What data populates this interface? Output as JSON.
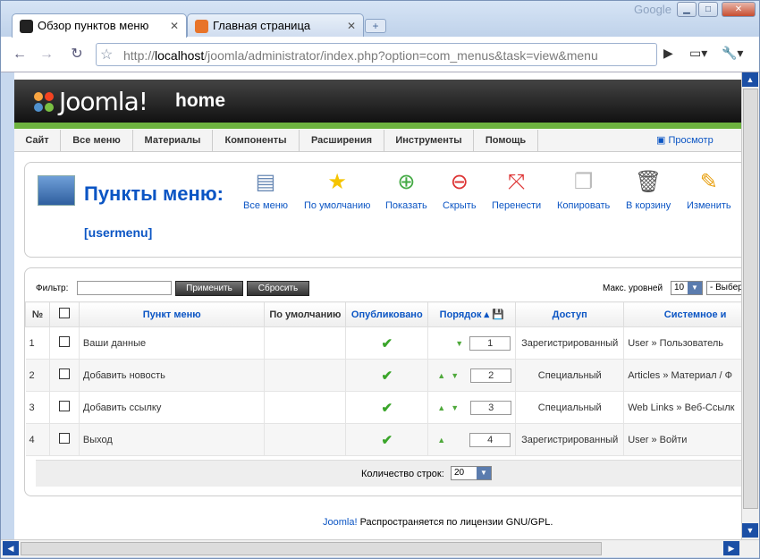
{
  "browser": {
    "tabs": [
      {
        "title": "Обзор пунктов меню"
      },
      {
        "title": "Главная страница"
      }
    ],
    "brand": "Google",
    "url_prefix": "http://",
    "url_host": "localhost",
    "url_rest": "/joomla/administrator/index.php?option=com_menus&task=view&menu"
  },
  "header": {
    "logo_text": "Joomla!",
    "site": "home"
  },
  "menu": {
    "items": [
      "Сайт",
      "Все меню",
      "Материалы",
      "Компоненты",
      "Расширения",
      "Инструменты",
      "Помощь"
    ],
    "preview": "Просмотр"
  },
  "page": {
    "title": "Пункты меню:",
    "subtitle": "[usermenu]"
  },
  "toolbar": {
    "items": [
      "Все меню",
      "По умолчанию",
      "Показать",
      "Скрыть",
      "Перенести",
      "Копировать",
      "В корзину",
      "Изменить"
    ]
  },
  "filter": {
    "label": "Фильтр:",
    "value": "",
    "apply": "Применить",
    "reset": "Сбросить",
    "max_levels_label": "Макс. уровней",
    "max_levels_value": "10",
    "select_placeholder": "- Выбер"
  },
  "table": {
    "headers": [
      "№",
      "",
      "Пункт меню",
      "По умолчанию",
      "Опубликовано",
      "Порядок",
      "Доступ",
      "Системное и"
    ],
    "rows": [
      {
        "num": "1",
        "name": "Ваши данные",
        "order": "1",
        "access": "Зарегистрированный",
        "access_red": true,
        "type": "User » Пользователь"
      },
      {
        "num": "2",
        "name": "Добавить новость",
        "order": "2",
        "access": "Специальный",
        "access_red": false,
        "type": "Articles » Материал / Ф"
      },
      {
        "num": "3",
        "name": "Добавить ссылку",
        "order": "3",
        "access": "Специальный",
        "access_red": false,
        "type": "Web Links » Веб-Ссылк"
      },
      {
        "num": "4",
        "name": "Выход",
        "order": "4",
        "access": "Зарегистрированный",
        "access_red": true,
        "type": "User » Войти"
      }
    ]
  },
  "pagination": {
    "label": "Количество строк:",
    "value": "20"
  },
  "footer": {
    "brand": "Joomla!",
    "text": " Распространяется по лицензии GNU/GPL."
  }
}
